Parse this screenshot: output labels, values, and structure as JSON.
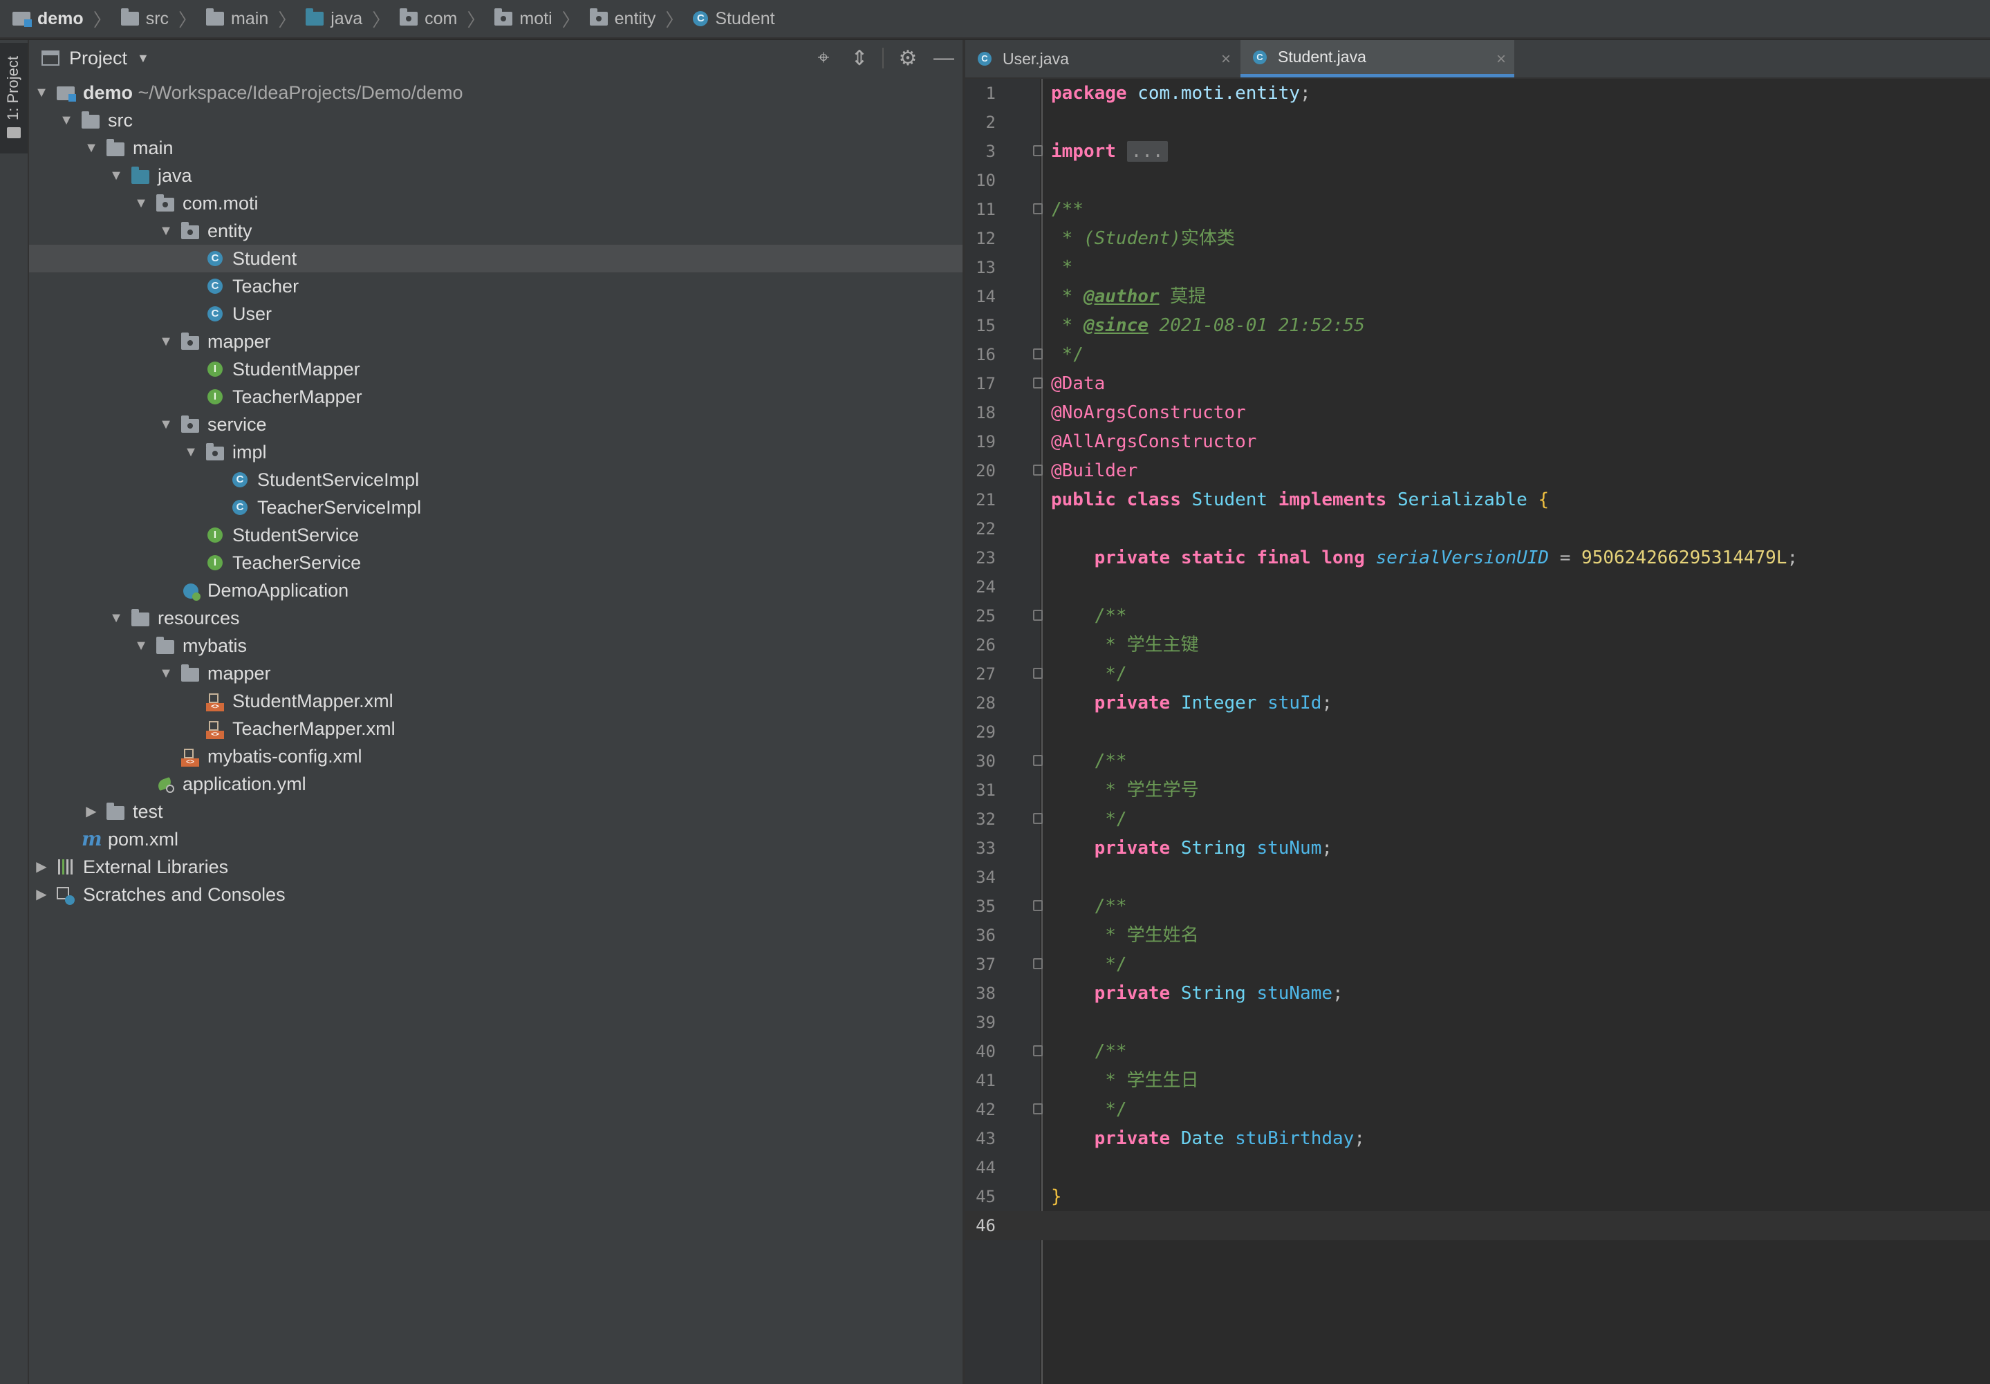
{
  "breadcrumb": [
    "demo",
    "src",
    "main",
    "java",
    "com",
    "moti",
    "entity",
    "Student"
  ],
  "tool_window_label": "1: Project",
  "project_panel": {
    "title": "Project",
    "tree": [
      {
        "label": "demo",
        "path": "~/Workspace/IdeaProjects/Demo/demo"
      },
      {
        "label": "src"
      },
      {
        "label": "main"
      },
      {
        "label": "java"
      },
      {
        "label": "com.moti"
      },
      {
        "label": "entity"
      },
      {
        "label": "Student"
      },
      {
        "label": "Teacher"
      },
      {
        "label": "User"
      },
      {
        "label": "mapper"
      },
      {
        "label": "StudentMapper"
      },
      {
        "label": "TeacherMapper"
      },
      {
        "label": "service"
      },
      {
        "label": "impl"
      },
      {
        "label": "StudentServiceImpl"
      },
      {
        "label": "TeacherServiceImpl"
      },
      {
        "label": "StudentService"
      },
      {
        "label": "TeacherService"
      },
      {
        "label": "DemoApplication"
      },
      {
        "label": "resources"
      },
      {
        "label": "mybatis"
      },
      {
        "label": "mapper"
      },
      {
        "label": "StudentMapper.xml"
      },
      {
        "label": "TeacherMapper.xml"
      },
      {
        "label": "mybatis-config.xml"
      },
      {
        "label": "application.yml"
      },
      {
        "label": "test"
      },
      {
        "label": "pom.xml"
      },
      {
        "label": "External Libraries"
      },
      {
        "label": "Scratches and Consoles"
      }
    ]
  },
  "editor": {
    "tabs": [
      {
        "label": "User.java"
      },
      {
        "label": "Student.java"
      }
    ],
    "line_numbers": [
      "1",
      "2",
      "3",
      "10",
      "11",
      "12",
      "13",
      "14",
      "15",
      "16",
      "17",
      "18",
      "19",
      "20",
      "21",
      "22",
      "23",
      "24",
      "25",
      "26",
      "27",
      "28",
      "29",
      "30",
      "31",
      "32",
      "33",
      "34",
      "35",
      "36",
      "37",
      "38",
      "39",
      "40",
      "41",
      "42",
      "43",
      "44",
      "45",
      "46"
    ],
    "code": {
      "l1_kw": "package",
      "l1_pkg": "com.moti.entity",
      "l3_kw": "import",
      "l3_folded": "...",
      "doc_open": "/**",
      "l12_a": " * ",
      "l12_b": "(Student)",
      "l12_c": "实体类",
      "l13": " *",
      "l14_a": " * ",
      "l14_tag": "@author",
      "l14_val": " 莫提",
      "l15_a": " * ",
      "l15_tag": "@since",
      "l15_val": " 2021-08-01 21:52:55",
      "doc_close": " */",
      "ann1": "@Data",
      "ann2": "@NoArgsConstructor",
      "ann3": "@AllArgsConstructor",
      "ann4": "@Builder",
      "l21_kw1": "public",
      "l21_kw2": "class",
      "l21_name": "Student",
      "l21_kw3": "implements",
      "l21_iface": "Serializable",
      "l21_brace": "{",
      "l23_kw": "private static final long",
      "l23_field": "serialVersionUID",
      "l23_eq": " = ",
      "l23_num": "950624266295314479L",
      "ind_doc_open": "    /**",
      "ind_doc_close": "     */",
      "c1": "     * 学生主键",
      "c2": "     * 学生学号",
      "c3": "     * 学生姓名",
      "c4": "     * 学生生日",
      "kw_private": "private",
      "f1_type": "Integer",
      "f1_name": "stuId",
      "f2_type": "String",
      "f2_name": "stuNum",
      "f3_type": "String",
      "f3_name": "stuName",
      "f4_type": "Date",
      "f4_name": "stuBirthday",
      "semi": ";",
      "close_brace": "}"
    }
  },
  "colors": {
    "background": "#2b2b2b",
    "panel": "#3c3f41",
    "keyword": "#ff7ab2",
    "comment": "#6a9955",
    "type": "#6cd3f2",
    "number": "#e6d37a",
    "active_tab_underline": "#4a88c7"
  },
  "icons": {
    "locate": "target-icon",
    "collapse": "collapse-all-icon",
    "settings": "gear-icon",
    "hide": "minimize-icon"
  }
}
